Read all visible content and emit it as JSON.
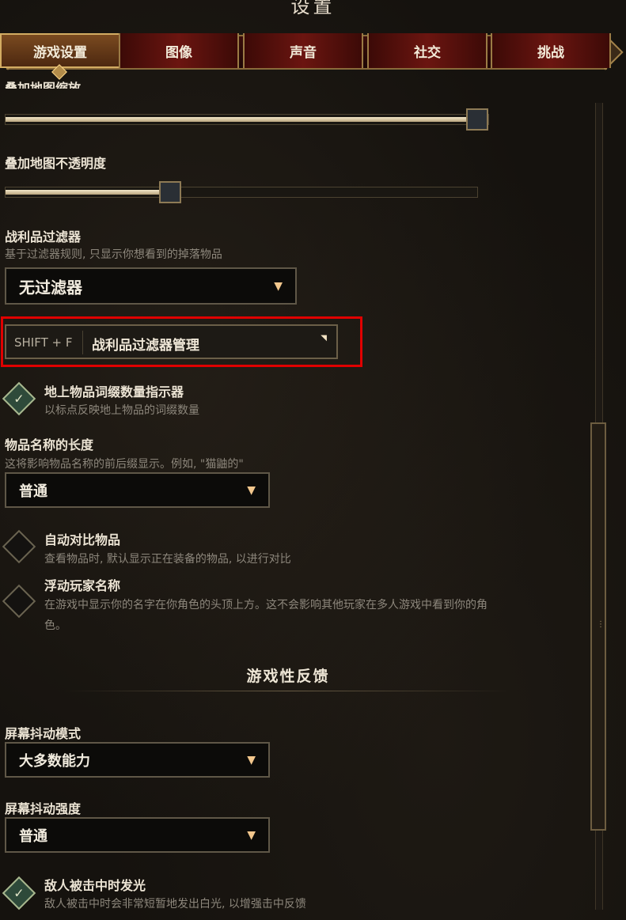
{
  "window": {
    "title": "设置"
  },
  "tabs": [
    {
      "label": "游戏设置",
      "active": true
    },
    {
      "label": "图像",
      "active": false
    },
    {
      "label": "声音",
      "active": false
    },
    {
      "label": "社交",
      "active": false
    },
    {
      "label": "挑战",
      "active": false
    }
  ],
  "settings": {
    "map_zoom": {
      "label": "叠加地图缩放",
      "value_percent": 100
    },
    "map_opacity": {
      "label": "叠加地图不透明度",
      "value_percent": 35
    },
    "loot_filter": {
      "label": "战利品过滤器",
      "desc": "基于过滤器规则, 只显示你想看到的掉落物品",
      "selected": "无过滤器",
      "hotkey": "SHIFT + F",
      "manage_label": "战利品过滤器管理"
    },
    "affix_indicator": {
      "label": "地上物品词缀数量指示器",
      "desc": "以标点反映地上物品的词缀数量",
      "checked": true
    },
    "item_name_length": {
      "label": "物品名称的长度",
      "desc": "这将影响物品名称的前后缀显示。例如, \"猫鼬的\"",
      "selected": "普通"
    },
    "auto_compare": {
      "label": "自动对比物品",
      "desc": "查看物品时, 默认显示正在装备的物品, 以进行对比",
      "checked": false
    },
    "floating_names": {
      "label": "浮动玩家名称",
      "desc_line1": "在游戏中显示你的名字在你角色的头顶上方。这不会影响其他玩家在多人游戏中看到你的角",
      "desc_line2": "色。",
      "checked": false
    }
  },
  "feedback": {
    "section_title": "游戏性反馈",
    "shake_mode": {
      "label": "屏幕抖动模式",
      "selected": "大多数能力"
    },
    "shake_intensity": {
      "label": "屏幕抖动强度",
      "selected": "普通"
    },
    "enemy_flash": {
      "label": "敌人被击中时发光",
      "desc": "敌人被击中时会非常短暂地发出白光, 以增强击中反馈",
      "checked": true
    }
  },
  "icons": {
    "dropdown_arrow": "▼",
    "check_mark": "✓",
    "corner_marker": "◥",
    "scroll_grip": "⋮"
  },
  "colors": {
    "highlight": "#e00000",
    "accent_gold": "#d3ac62"
  }
}
